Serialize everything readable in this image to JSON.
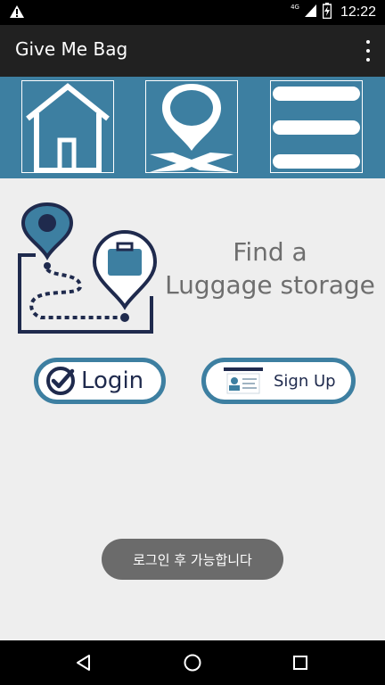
{
  "status_bar": {
    "time": "12:22",
    "network": "4G",
    "icons": [
      "warning-icon",
      "signal-icon",
      "battery-charging-icon"
    ]
  },
  "app_bar": {
    "title": "Give Me Bag",
    "overflow_icon": "overflow-menu-icon"
  },
  "nav_tiles": [
    {
      "name": "home",
      "icon": "home-icon"
    },
    {
      "name": "map",
      "icon": "map-pin-icon"
    },
    {
      "name": "menu",
      "icon": "menu-icon"
    }
  ],
  "hero": {
    "line1": "Find a",
    "line2": "Luggage storage",
    "graphic_icon": "luggage-route-icon"
  },
  "buttons": {
    "login_label": "Login",
    "signup_label": "Sign Up"
  },
  "toast": {
    "message": "로그인 후 가능합니다"
  },
  "system_nav": {
    "back_icon": "back-icon",
    "home_icon": "home-circle-icon",
    "recents_icon": "recents-icon"
  },
  "colors": {
    "accent": "#3d7fa1",
    "dark_navy": "#1f2a4d",
    "app_bar": "#212121",
    "background": "#eeeeee",
    "toast": "#6b6b6b"
  }
}
